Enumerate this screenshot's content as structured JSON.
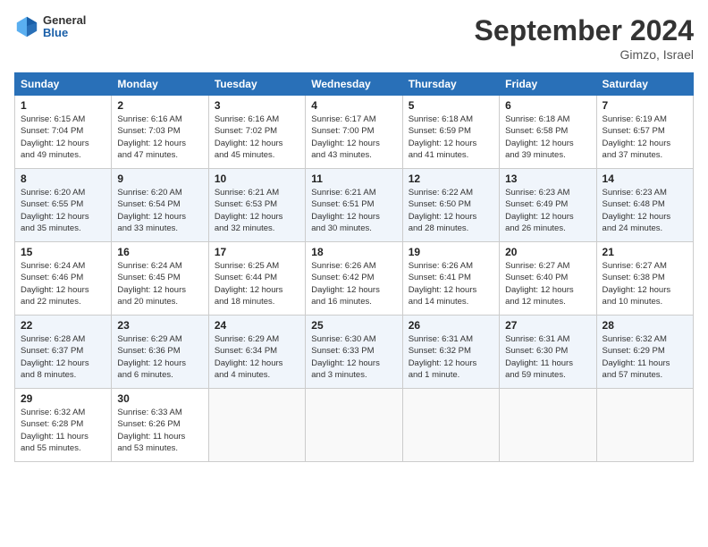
{
  "logo": {
    "general": "General",
    "blue": "Blue"
  },
  "title": "September 2024",
  "location": "Gimzo, Israel",
  "days_header": [
    "Sunday",
    "Monday",
    "Tuesday",
    "Wednesday",
    "Thursday",
    "Friday",
    "Saturday"
  ],
  "weeks": [
    [
      {
        "day": "1",
        "info": "Sunrise: 6:15 AM\nSunset: 7:04 PM\nDaylight: 12 hours\nand 49 minutes."
      },
      {
        "day": "2",
        "info": "Sunrise: 6:16 AM\nSunset: 7:03 PM\nDaylight: 12 hours\nand 47 minutes."
      },
      {
        "day": "3",
        "info": "Sunrise: 6:16 AM\nSunset: 7:02 PM\nDaylight: 12 hours\nand 45 minutes."
      },
      {
        "day": "4",
        "info": "Sunrise: 6:17 AM\nSunset: 7:00 PM\nDaylight: 12 hours\nand 43 minutes."
      },
      {
        "day": "5",
        "info": "Sunrise: 6:18 AM\nSunset: 6:59 PM\nDaylight: 12 hours\nand 41 minutes."
      },
      {
        "day": "6",
        "info": "Sunrise: 6:18 AM\nSunset: 6:58 PM\nDaylight: 12 hours\nand 39 minutes."
      },
      {
        "day": "7",
        "info": "Sunrise: 6:19 AM\nSunset: 6:57 PM\nDaylight: 12 hours\nand 37 minutes."
      }
    ],
    [
      {
        "day": "8",
        "info": "Sunrise: 6:20 AM\nSunset: 6:55 PM\nDaylight: 12 hours\nand 35 minutes."
      },
      {
        "day": "9",
        "info": "Sunrise: 6:20 AM\nSunset: 6:54 PM\nDaylight: 12 hours\nand 33 minutes."
      },
      {
        "day": "10",
        "info": "Sunrise: 6:21 AM\nSunset: 6:53 PM\nDaylight: 12 hours\nand 32 minutes."
      },
      {
        "day": "11",
        "info": "Sunrise: 6:21 AM\nSunset: 6:51 PM\nDaylight: 12 hours\nand 30 minutes."
      },
      {
        "day": "12",
        "info": "Sunrise: 6:22 AM\nSunset: 6:50 PM\nDaylight: 12 hours\nand 28 minutes."
      },
      {
        "day": "13",
        "info": "Sunrise: 6:23 AM\nSunset: 6:49 PM\nDaylight: 12 hours\nand 26 minutes."
      },
      {
        "day": "14",
        "info": "Sunrise: 6:23 AM\nSunset: 6:48 PM\nDaylight: 12 hours\nand 24 minutes."
      }
    ],
    [
      {
        "day": "15",
        "info": "Sunrise: 6:24 AM\nSunset: 6:46 PM\nDaylight: 12 hours\nand 22 minutes."
      },
      {
        "day": "16",
        "info": "Sunrise: 6:24 AM\nSunset: 6:45 PM\nDaylight: 12 hours\nand 20 minutes."
      },
      {
        "day": "17",
        "info": "Sunrise: 6:25 AM\nSunset: 6:44 PM\nDaylight: 12 hours\nand 18 minutes."
      },
      {
        "day": "18",
        "info": "Sunrise: 6:26 AM\nSunset: 6:42 PM\nDaylight: 12 hours\nand 16 minutes."
      },
      {
        "day": "19",
        "info": "Sunrise: 6:26 AM\nSunset: 6:41 PM\nDaylight: 12 hours\nand 14 minutes."
      },
      {
        "day": "20",
        "info": "Sunrise: 6:27 AM\nSunset: 6:40 PM\nDaylight: 12 hours\nand 12 minutes."
      },
      {
        "day": "21",
        "info": "Sunrise: 6:27 AM\nSunset: 6:38 PM\nDaylight: 12 hours\nand 10 minutes."
      }
    ],
    [
      {
        "day": "22",
        "info": "Sunrise: 6:28 AM\nSunset: 6:37 PM\nDaylight: 12 hours\nand 8 minutes."
      },
      {
        "day": "23",
        "info": "Sunrise: 6:29 AM\nSunset: 6:36 PM\nDaylight: 12 hours\nand 6 minutes."
      },
      {
        "day": "24",
        "info": "Sunrise: 6:29 AM\nSunset: 6:34 PM\nDaylight: 12 hours\nand 4 minutes."
      },
      {
        "day": "25",
        "info": "Sunrise: 6:30 AM\nSunset: 6:33 PM\nDaylight: 12 hours\nand 3 minutes."
      },
      {
        "day": "26",
        "info": "Sunrise: 6:31 AM\nSunset: 6:32 PM\nDaylight: 12 hours\nand 1 minute."
      },
      {
        "day": "27",
        "info": "Sunrise: 6:31 AM\nSunset: 6:30 PM\nDaylight: 11 hours\nand 59 minutes."
      },
      {
        "day": "28",
        "info": "Sunrise: 6:32 AM\nSunset: 6:29 PM\nDaylight: 11 hours\nand 57 minutes."
      }
    ],
    [
      {
        "day": "29",
        "info": "Sunrise: 6:32 AM\nSunset: 6:28 PM\nDaylight: 11 hours\nand 55 minutes."
      },
      {
        "day": "30",
        "info": "Sunrise: 6:33 AM\nSunset: 6:26 PM\nDaylight: 11 hours\nand 53 minutes."
      },
      null,
      null,
      null,
      null,
      null
    ]
  ]
}
